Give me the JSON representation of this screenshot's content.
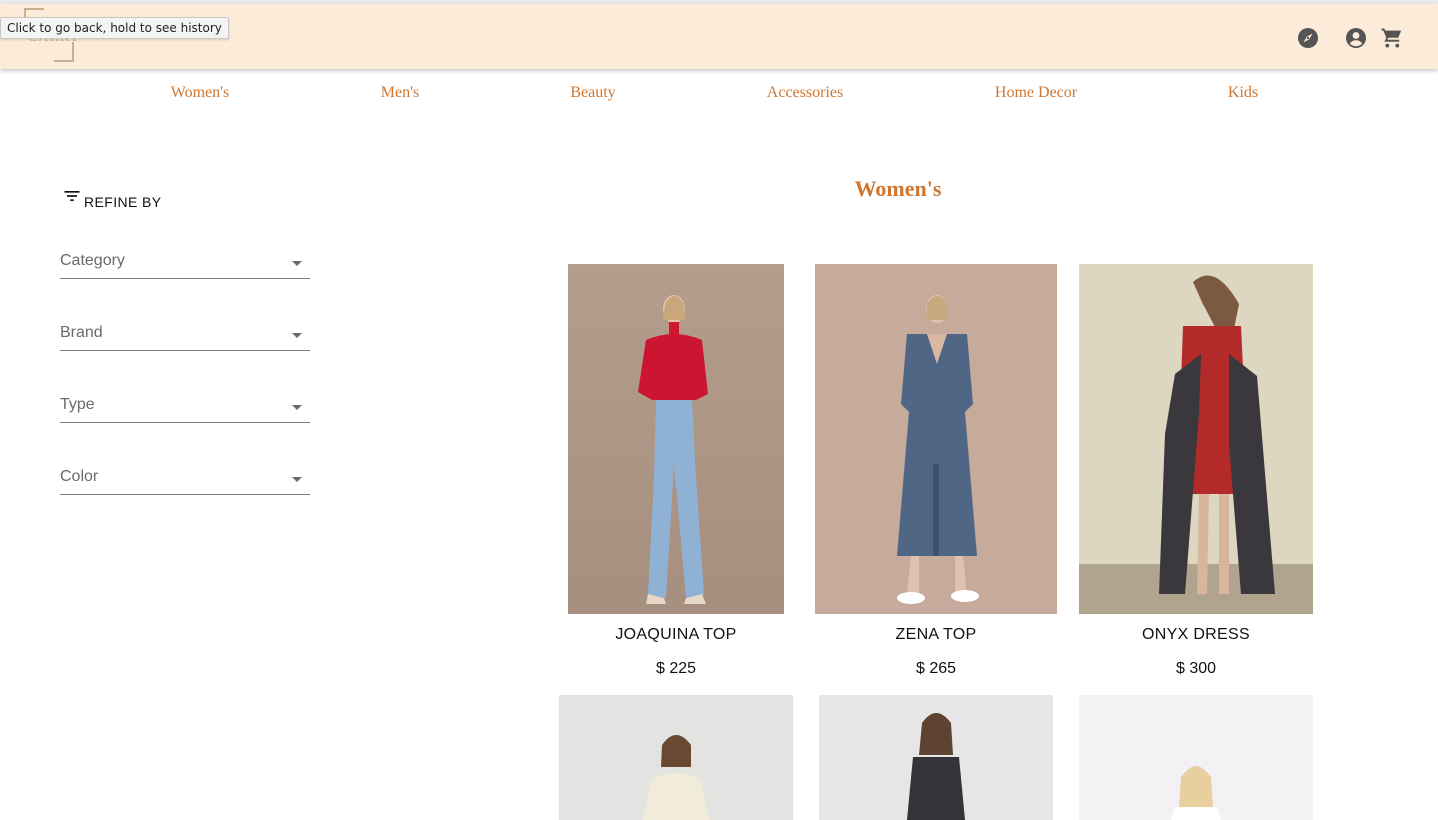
{
  "header": {
    "logo_text": "CARRY",
    "tooltip": "Click to go back, hold to see history",
    "icons": [
      "compass-icon",
      "account-icon",
      "cart-icon"
    ],
    "background": "#fcebd9"
  },
  "nav": {
    "items": [
      "Women's",
      "Men's",
      "Beauty",
      "Accessories",
      "Home Decor",
      "Kids"
    ],
    "color": "#d0762f"
  },
  "sidebar": {
    "refine_label": "REFINE BY",
    "filters": [
      "Category",
      "Brand",
      "Type",
      "Color"
    ]
  },
  "main": {
    "title": "Women's",
    "products": [
      {
        "name": "JOAQUINA TOP",
        "price": "$ 225"
      },
      {
        "name": "ZENA TOP",
        "price": "$ 265"
      },
      {
        "name": "ONYX DRESS",
        "price": "$ 300"
      }
    ]
  }
}
